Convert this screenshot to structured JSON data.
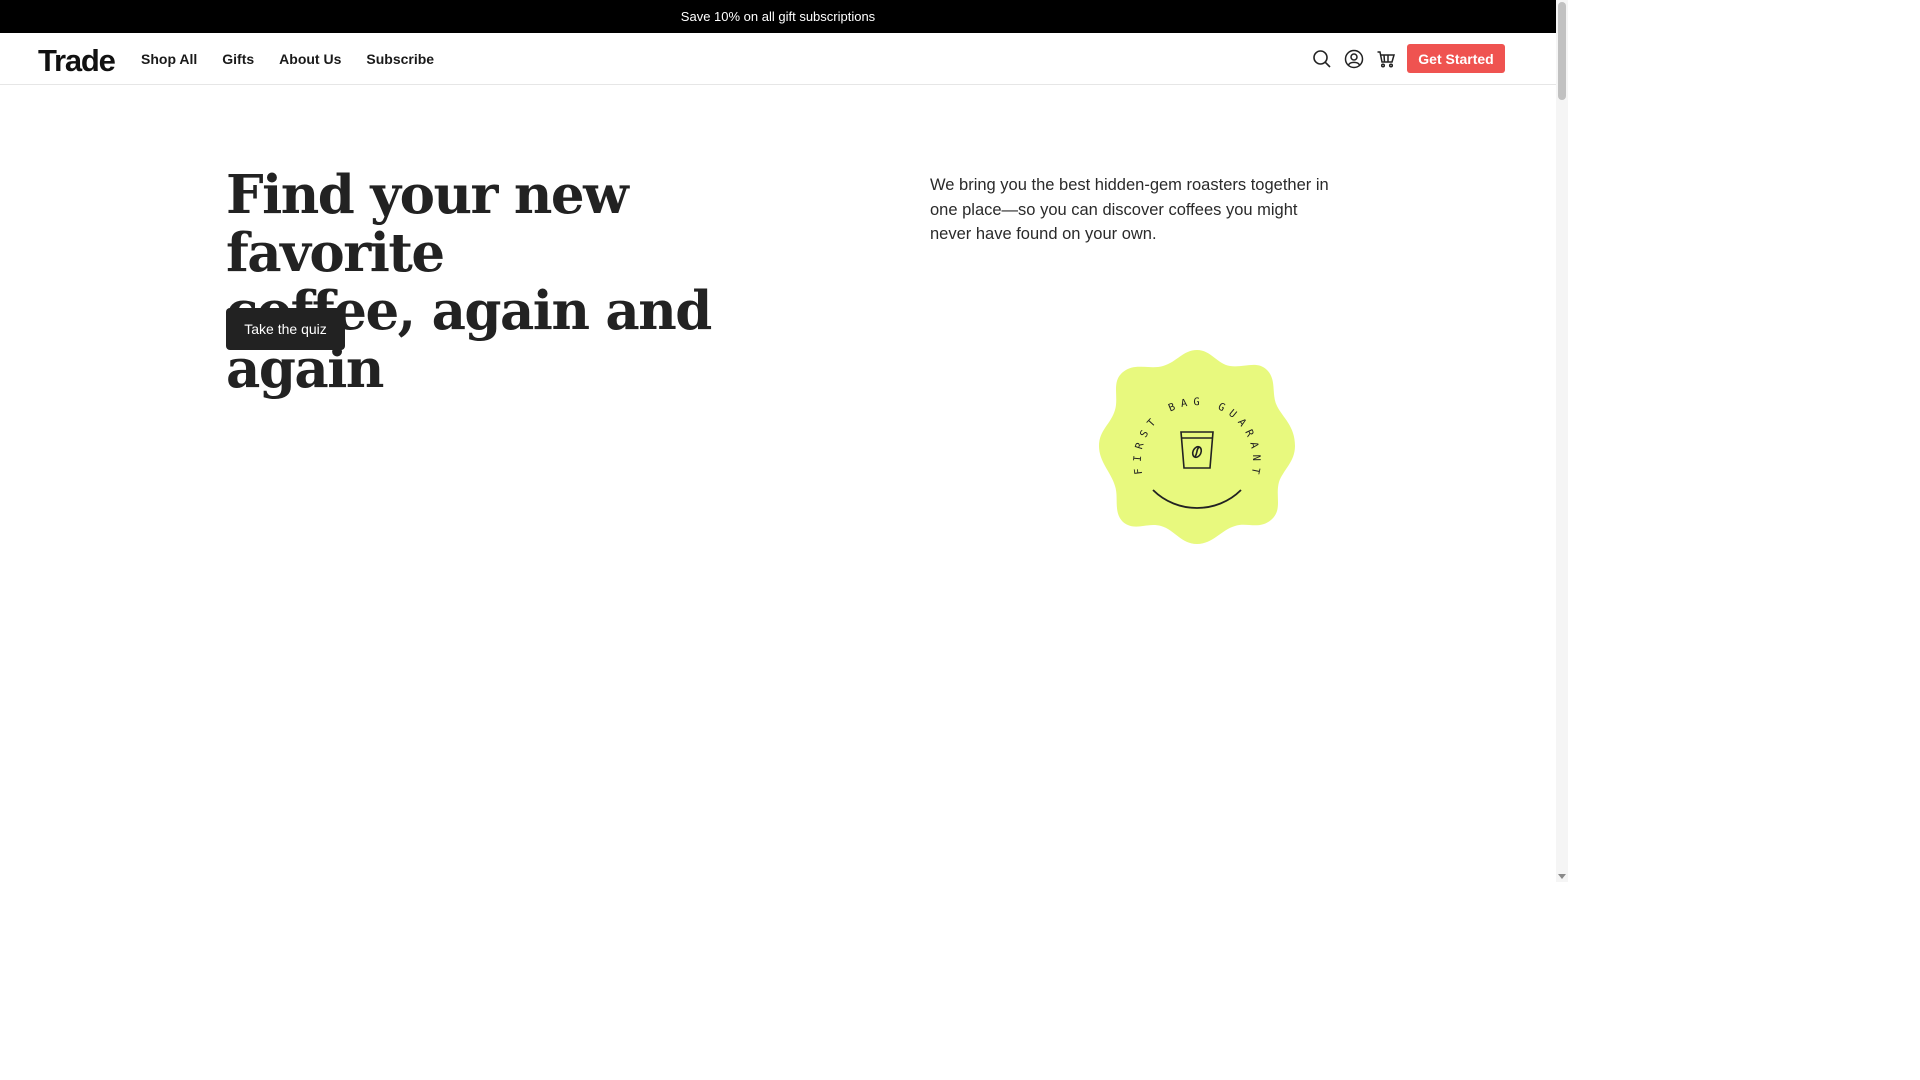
{
  "promo": {
    "text": "Save 10% on all gift subscriptions"
  },
  "header": {
    "logo": "Trade",
    "nav": [
      "Shop All",
      "Gifts",
      "About Us",
      "Subscribe"
    ],
    "icons": [
      "search-icon",
      "account-icon",
      "cart-icon"
    ],
    "cta": "Get Started"
  },
  "hero": {
    "title_line1": "Find your new favorite",
    "title_line2": "coffee, again and again",
    "quiz_button": "Take the quiz",
    "description": "We bring you the best hidden-gem roasters together in one place—so you can discover coffees you might never have found on your own."
  },
  "badge": {
    "text": "FIRST BAG GUARANTEED",
    "color": "#e8f97e"
  },
  "colors": {
    "cta": "#ef5350",
    "dark": "#222222",
    "promo_bg": "#000000"
  }
}
